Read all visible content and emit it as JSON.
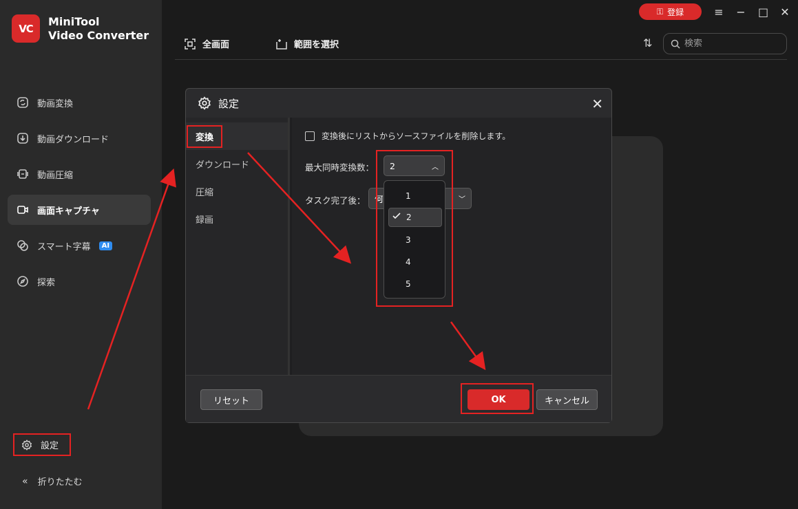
{
  "app": {
    "logo_text": "VC",
    "name_line1": "MiniTool",
    "name_line2": "Video Converter"
  },
  "titlebar": {
    "login_label": "登録"
  },
  "sidebar": {
    "items": [
      {
        "label": "動画変換",
        "icon": "convert-icon"
      },
      {
        "label": "動画ダウンロード",
        "icon": "download-icon"
      },
      {
        "label": "動画圧縮",
        "icon": "compress-icon"
      },
      {
        "label": "画面キャプチャ",
        "icon": "camera-icon",
        "active": true
      },
      {
        "label": "スマート字幕",
        "icon": "subtitle-icon",
        "badge": "AI"
      },
      {
        "label": "探索",
        "icon": "compass-icon"
      }
    ],
    "settings_label": "設定",
    "collapse_label": "折りたたむ"
  },
  "toolbar": {
    "fullscreen_label": "全画面",
    "select_area_label": "範囲を選択",
    "search_placeholder": "検索"
  },
  "dialog": {
    "title": "設定",
    "tabs": [
      {
        "label": "変換",
        "active": true
      },
      {
        "label": "ダウンロード"
      },
      {
        "label": "圧縮"
      },
      {
        "label": "録画"
      }
    ],
    "delete_source_label": "変換後にリストからソースファイルを削除します。",
    "max_concurrent_label": "最大同時変換数：",
    "max_concurrent_value": "2",
    "after_task_label": "タスク完了後：",
    "after_task_value": "何",
    "dropdown_options": [
      "1",
      "2",
      "3",
      "4",
      "5"
    ],
    "dropdown_selected": "2",
    "reset_label": "リセット",
    "ok_label": "OK",
    "cancel_label": "キャンセル"
  },
  "colors": {
    "accent": "#d92a2a",
    "highlight": "#e52222"
  }
}
